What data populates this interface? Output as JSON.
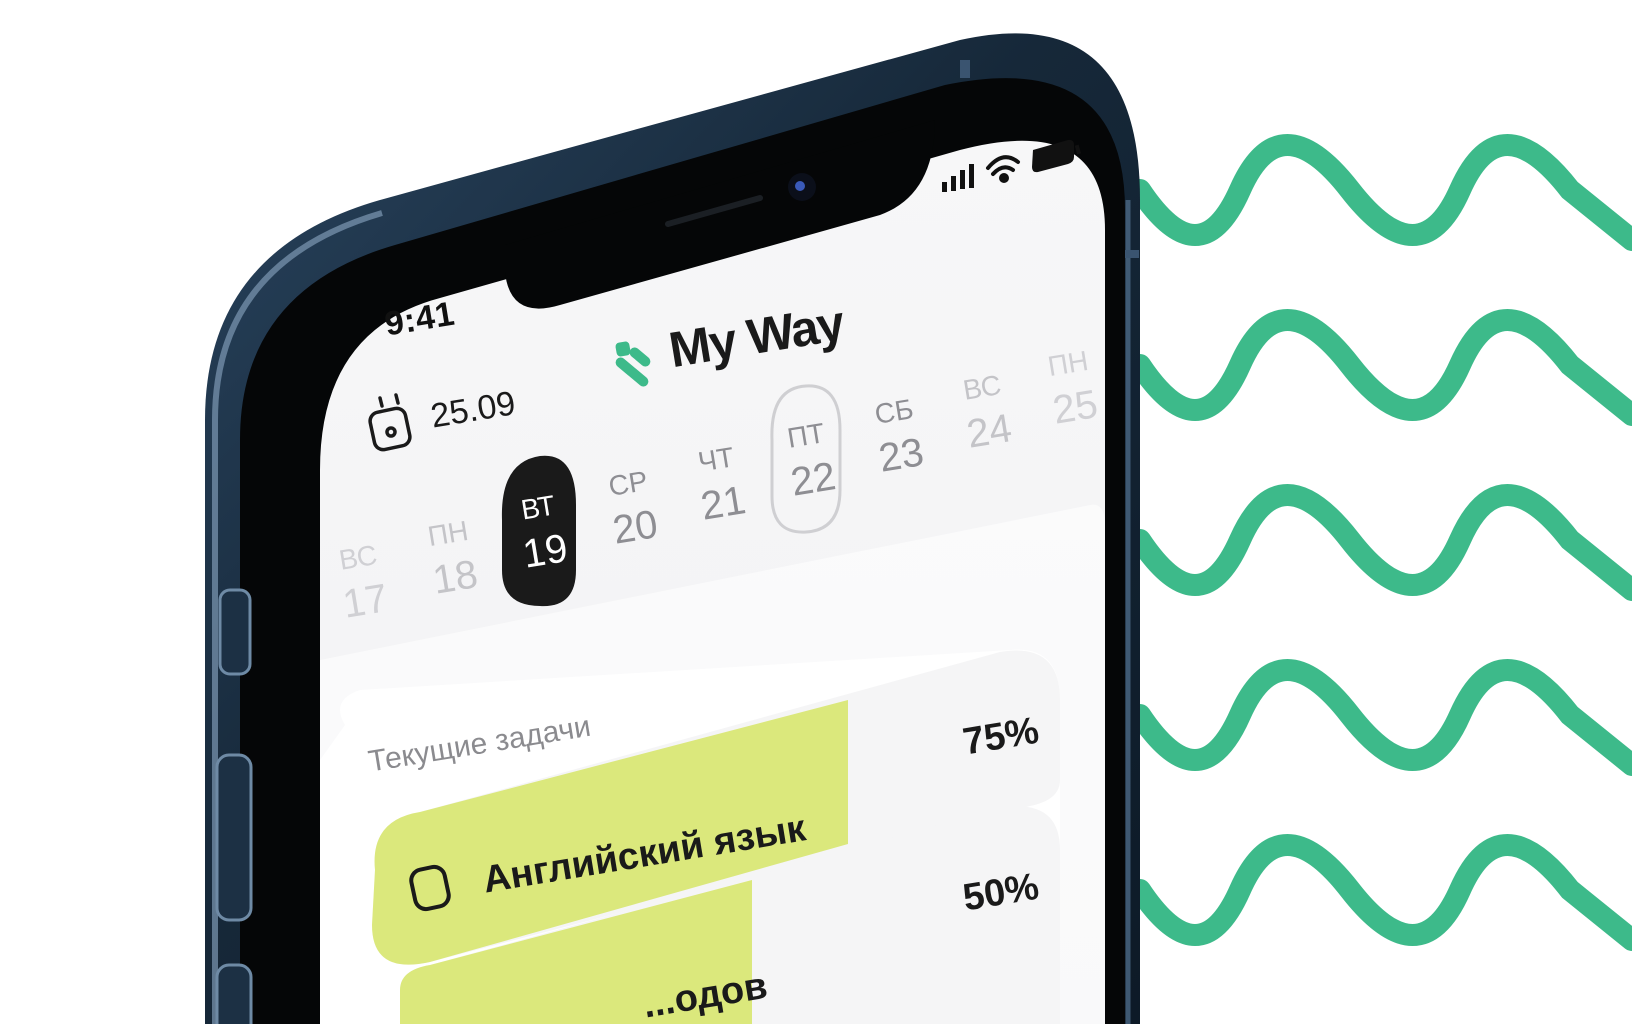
{
  "status_bar": {
    "time": "9:41",
    "signal_icon": "signal-bars-icon",
    "wifi_icon": "wifi-icon",
    "battery_icon": "battery-icon"
  },
  "header": {
    "brand": "My Way",
    "logo_icon": "my-way-logo-icon"
  },
  "date_picker": {
    "icon": "calendar-icon",
    "date": "25.09"
  },
  "week": [
    {
      "dow": "ВС",
      "num": "17",
      "state": "past"
    },
    {
      "dow": "ПН",
      "num": "18",
      "state": "past"
    },
    {
      "dow": "ВТ",
      "num": "19",
      "state": "selected"
    },
    {
      "dow": "СР",
      "num": "20",
      "state": "normal"
    },
    {
      "dow": "ЧТ",
      "num": "21",
      "state": "normal"
    },
    {
      "dow": "ПТ",
      "num": "22",
      "state": "today"
    },
    {
      "dow": "СБ",
      "num": "23",
      "state": "normal"
    },
    {
      "dow": "ВС",
      "num": "24",
      "state": "future"
    },
    {
      "dow": "ПН",
      "num": "25",
      "state": "future"
    }
  ],
  "tasks_section": {
    "title": "Текущие задачи",
    "items": [
      {
        "name": "Английский язык",
        "progress": "75%",
        "fill": 0.75,
        "checkbox_icon": "checkbox-empty-icon"
      },
      {
        "name": "...одов",
        "progress": "50%",
        "fill": 0.5
      }
    ]
  },
  "colors": {
    "brand_green": "#3dba8a",
    "progress_fill": "#dbe87c",
    "phone_frame": "#1c3044",
    "selected_day_bg": "#1a1a1a"
  }
}
